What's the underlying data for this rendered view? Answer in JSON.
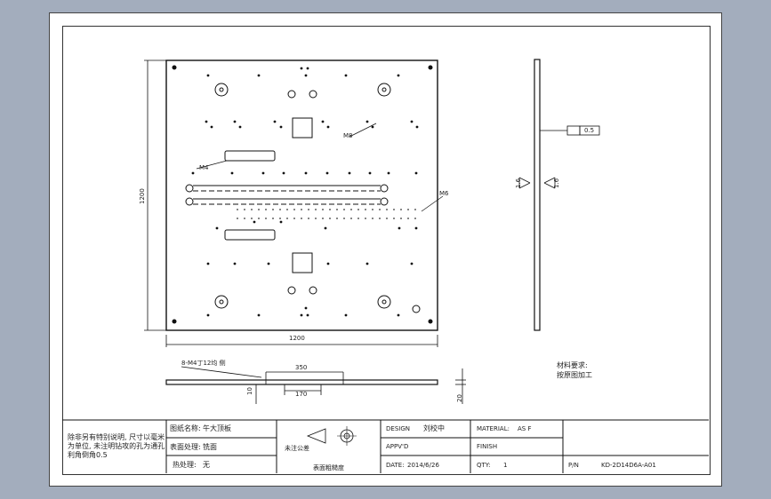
{
  "dims": {
    "front_height": "1200",
    "front_width": "1200",
    "side_thickness": "20",
    "bottom_hole_span": "350",
    "bottom_hole_offset": "170",
    "bottom_thickness": "10",
    "thread_callout": "8-M4丁12均 侧"
  },
  "callouts": {
    "m4": "M4",
    "m8": "M8",
    "m6": "M6",
    "flatness_value": "0.5",
    "roughness_a": "1.6",
    "roughness_b": "1.6"
  },
  "notes": {
    "material_req_title": "材料要求:",
    "material_req_body": "按原图加工"
  },
  "title_block": {
    "general_note_line1": "除非另有特别说明, 尺寸以毫米",
    "general_note_line2": "为单位, 未注明钻攻的孔为通孔",
    "general_note_line3": "利角倒角0.5",
    "part_name_label": "图纸名称:",
    "part_name_value": "午大顶板",
    "surface_label": "表面处理:",
    "surface_value": "铣面",
    "heat_label": "热处理:",
    "heat_value": "无",
    "design_label": "DESIGN",
    "design_value": "刘校中",
    "approved_label": "APPV'D",
    "date_label": "DATE:",
    "date_value": "2014/6/26",
    "material_label": "MATERIAL:",
    "material_value": "AS F",
    "finish_label": "FINISH",
    "qty_label": "QTY:",
    "qty_value": "1",
    "pn_label": "P/N",
    "pn_value": "KD-2D14D6A-A01",
    "tolerance_title": "未注公差",
    "roughness_title": "表面粗糙度"
  }
}
